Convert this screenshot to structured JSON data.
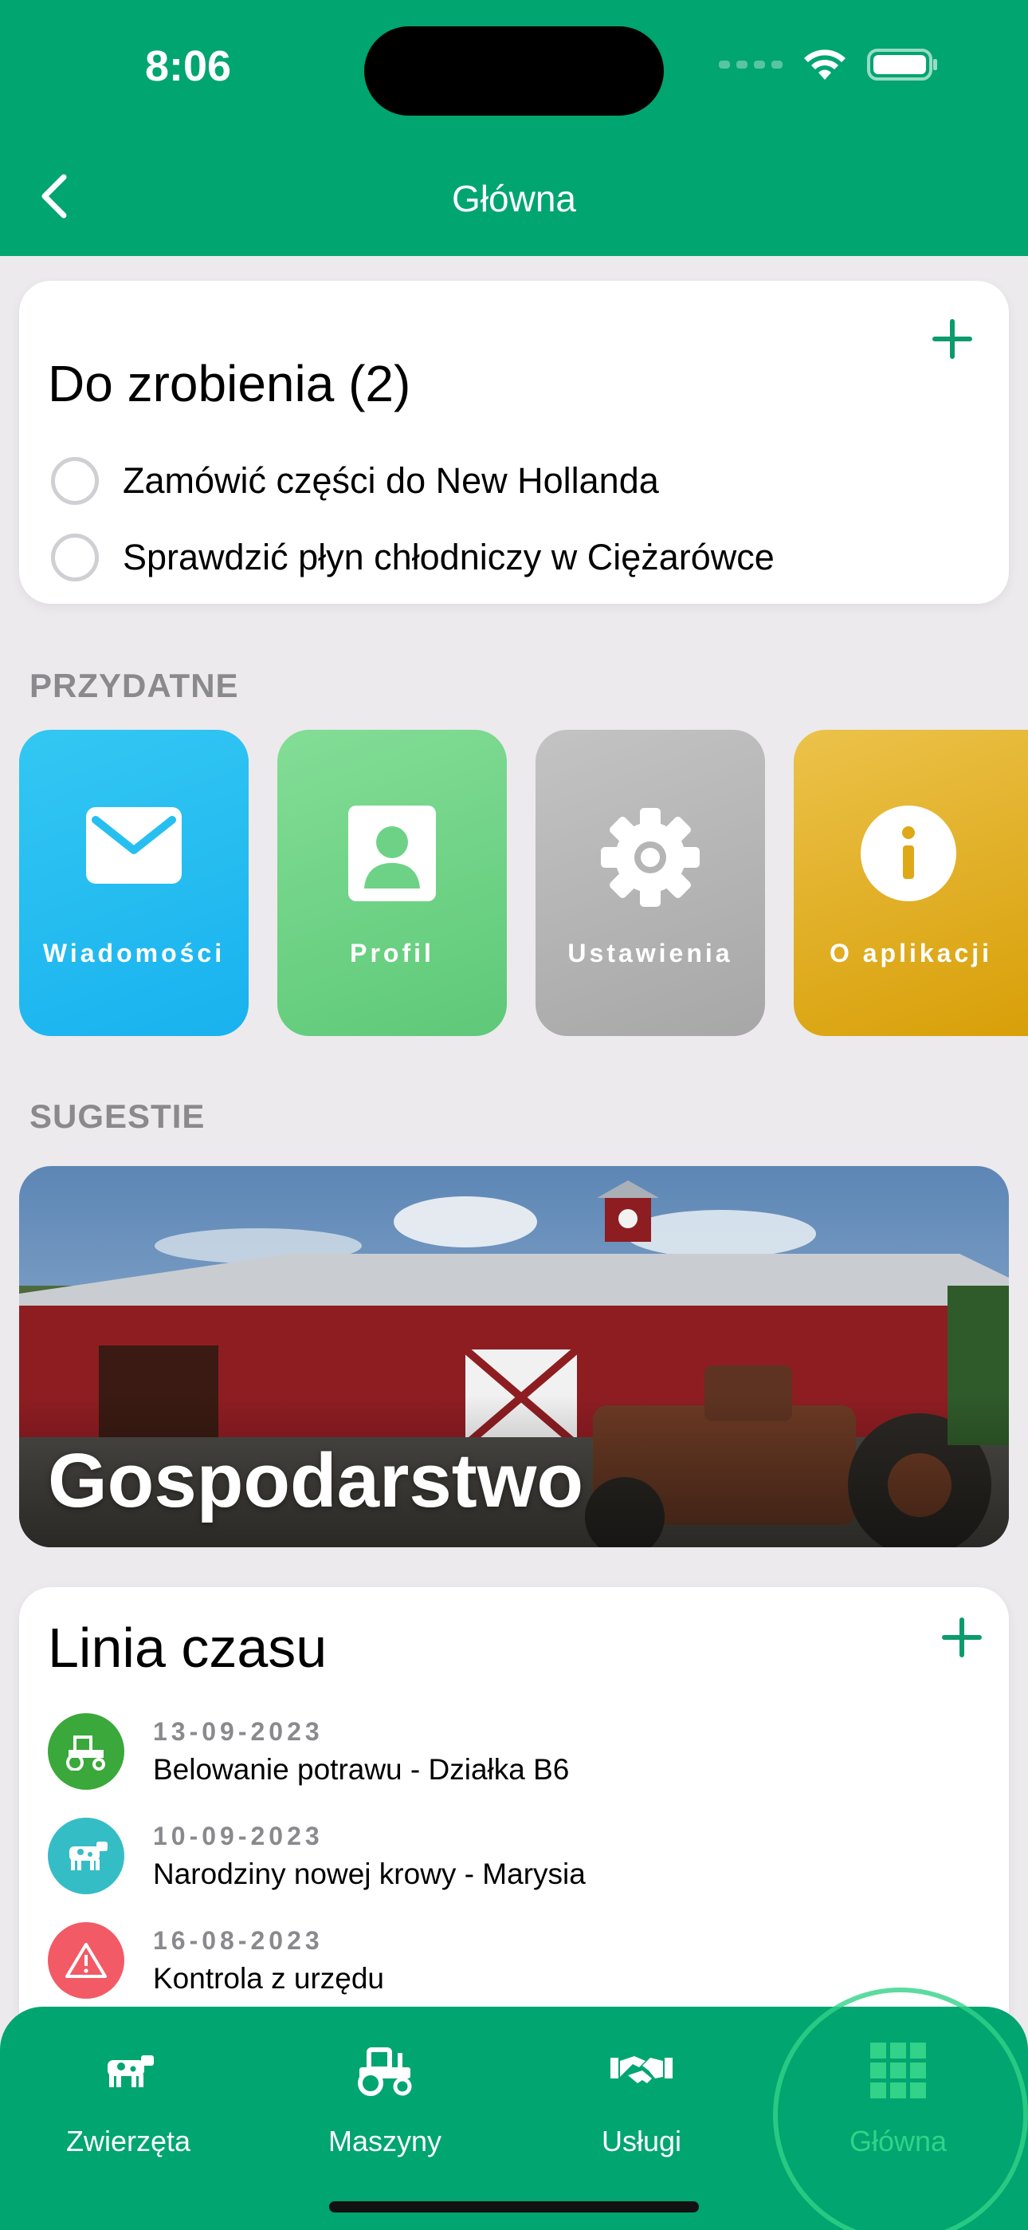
{
  "status_bar": {
    "time": "8:06"
  },
  "nav": {
    "title": "Główna"
  },
  "todo": {
    "title": "Do zrobienia (2)",
    "items": [
      {
        "text": "Zamówić części do New Hollanda",
        "done": false
      },
      {
        "text": "Sprawdzić płyn chłodniczy w Ciężarówce",
        "done": false
      }
    ]
  },
  "useful": {
    "label": "PRZYDATNE",
    "tiles": [
      {
        "label": "Wiadomości",
        "icon": "mail-icon"
      },
      {
        "label": "Profil",
        "icon": "person-icon"
      },
      {
        "label": "Ustawienia",
        "icon": "gear-icon"
      },
      {
        "label": "O aplikacji",
        "icon": "info-icon"
      }
    ]
  },
  "suggestions": {
    "label": "SUGESTIE",
    "card_title": "Gospodarstwo"
  },
  "timeline": {
    "title": "Linia czasu",
    "items": [
      {
        "date": "13-09-2023",
        "text": "Belowanie potrawu - Działka B6",
        "icon": "tractor-icon",
        "color": "#3aa83a"
      },
      {
        "date": "10-09-2023",
        "text": "Narodziny nowej krowy - Marysia",
        "icon": "cow-icon",
        "color": "#35bdc6"
      },
      {
        "date": "16-08-2023",
        "text": "Kontrola z urzędu",
        "icon": "warning-icon",
        "color": "#f25a66"
      }
    ]
  },
  "tabs": [
    {
      "label": "Zwierzęta",
      "icon": "cow-icon"
    },
    {
      "label": "Maszyny",
      "icon": "tractor-icon"
    },
    {
      "label": "Usługi",
      "icon": "handshake-icon"
    },
    {
      "label": "Główna",
      "icon": "grid-icon",
      "active": true
    }
  ],
  "colors": {
    "brand": "#00a56f",
    "accent": "#32d288"
  }
}
